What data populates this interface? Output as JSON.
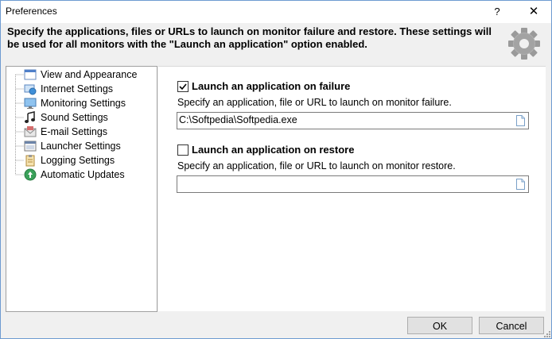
{
  "window": {
    "title": "Preferences"
  },
  "titlebar": {
    "help_glyph": "?",
    "close_glyph": "✕"
  },
  "header": {
    "text": "Specify the applications, files or URLs to launch on monitor failure and restore. These settings will be used for all monitors with the \"Launch an application\" option enabled."
  },
  "tree": {
    "items": [
      {
        "label": "View and Appearance",
        "icon": "window-icon"
      },
      {
        "label": "Internet Settings",
        "icon": "globe-network-icon"
      },
      {
        "label": "Monitoring Settings",
        "icon": "monitor-icon"
      },
      {
        "label": "Sound Settings",
        "icon": "music-note-icon"
      },
      {
        "label": "E-mail Settings",
        "icon": "envelope-icon"
      },
      {
        "label": "Launcher Settings",
        "icon": "launcher-window-icon"
      },
      {
        "label": "Logging Settings",
        "icon": "clipboard-icon"
      },
      {
        "label": "Automatic Updates",
        "icon": "update-globe-icon"
      }
    ]
  },
  "failure": {
    "checked": true,
    "label": "Launch an application on failure",
    "description": "Specify an application, file or URL to launch on monitor failure.",
    "value": "C:\\Softpedia\\Softpedia.exe"
  },
  "restore": {
    "checked": false,
    "label": "Launch an application on restore",
    "description": "Specify an application, file or URL to launch on monitor restore.",
    "value": ""
  },
  "footer": {
    "ok_label": "OK",
    "cancel_label": "Cancel"
  }
}
